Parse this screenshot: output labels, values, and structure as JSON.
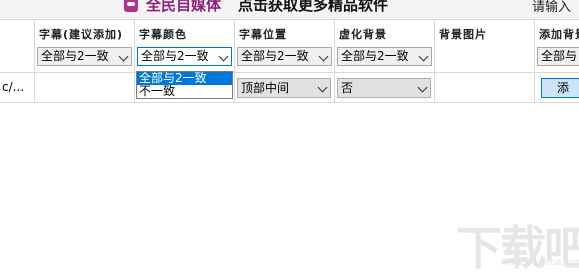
{
  "banner": {
    "brand": "全民自媒体",
    "promo": "点击获取更多精品软件",
    "search_hint": "请输入"
  },
  "columns": [
    {
      "title": "字幕(建议添加)",
      "value": "全部与2一致"
    },
    {
      "title": "字幕颜色",
      "value": "全部与2一致"
    },
    {
      "title": "字幕位置",
      "value": "全部与2一致"
    },
    {
      "title": "虚化背景",
      "value": "全部与2一致"
    },
    {
      "title": "背景图片"
    },
    {
      "title": "添加背景",
      "value": "全部与"
    }
  ],
  "row": {
    "path": "c/...",
    "position": "顶部中间",
    "blur": "否",
    "add_label": "添"
  },
  "dropdown": {
    "options": [
      "全部与2一致",
      "不一致"
    ],
    "selected_index": 0
  },
  "watermark": {
    "text": "下载吧",
    "sub": "www.xiazaiba.com"
  },
  "colors": {
    "brand": "#8f1f7a",
    "selection": "#0078d7",
    "button_bg": "#cce4f7"
  }
}
